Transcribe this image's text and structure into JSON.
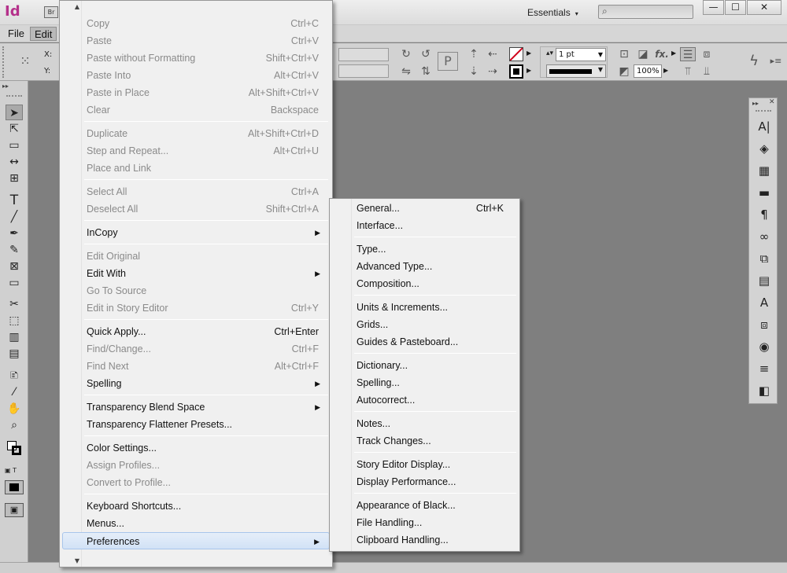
{
  "app": {
    "logo": "Id",
    "bridge": "Br",
    "workspace": "Essentials",
    "workspace_arrow": "▾"
  },
  "window_controls": {
    "minimize": "—",
    "maximize": "☐",
    "close": "✕"
  },
  "menubar": {
    "file": "File",
    "edit": "Edit"
  },
  "control_panel": {
    "x_label": "X:",
    "y_label": "Y:",
    "stroke_weight": "1 pt",
    "zoom_percent": "100%",
    "fx_label": "fx."
  },
  "edit_menu": {
    "items": [
      {
        "label": "Copy",
        "shortcut": "Ctrl+C",
        "enabled": false
      },
      {
        "label": "Paste",
        "shortcut": "Ctrl+V",
        "enabled": false
      },
      {
        "label": "Paste without Formatting",
        "shortcut": "Shift+Ctrl+V",
        "enabled": false
      },
      {
        "label": "Paste Into",
        "shortcut": "Alt+Ctrl+V",
        "enabled": false
      },
      {
        "label": "Paste in Place",
        "shortcut": "Alt+Shift+Ctrl+V",
        "enabled": false
      },
      {
        "label": "Clear",
        "shortcut": "Backspace",
        "enabled": false
      },
      {
        "label": "Duplicate",
        "shortcut": "Alt+Shift+Ctrl+D",
        "enabled": false
      },
      {
        "label": "Step and Repeat...",
        "shortcut": "Alt+Ctrl+U",
        "enabled": false
      },
      {
        "label": "Place and Link",
        "shortcut": "",
        "enabled": false
      },
      {
        "label": "Select All",
        "shortcut": "Ctrl+A",
        "enabled": false
      },
      {
        "label": "Deselect All",
        "shortcut": "Shift+Ctrl+A",
        "enabled": false
      },
      {
        "label": "InCopy",
        "shortcut": "",
        "enabled": true,
        "submenu": true
      },
      {
        "label": "Edit Original",
        "shortcut": "",
        "enabled": false
      },
      {
        "label": "Edit With",
        "shortcut": "",
        "enabled": true,
        "submenu": true
      },
      {
        "label": "Go To Source",
        "shortcut": "",
        "enabled": false
      },
      {
        "label": "Edit in Story Editor",
        "shortcut": "Ctrl+Y",
        "enabled": false
      },
      {
        "label": "Quick Apply...",
        "shortcut": "Ctrl+Enter",
        "enabled": true
      },
      {
        "label": "Find/Change...",
        "shortcut": "Ctrl+F",
        "enabled": false
      },
      {
        "label": "Find Next",
        "shortcut": "Alt+Ctrl+F",
        "enabled": false
      },
      {
        "label": "Spelling",
        "shortcut": "",
        "enabled": true,
        "submenu": true
      },
      {
        "label": "Transparency Blend Space",
        "shortcut": "",
        "enabled": true,
        "submenu": true
      },
      {
        "label": "Transparency Flattener Presets...",
        "shortcut": "",
        "enabled": true
      },
      {
        "label": "Color Settings...",
        "shortcut": "",
        "enabled": true
      },
      {
        "label": "Assign Profiles...",
        "shortcut": "",
        "enabled": false
      },
      {
        "label": "Convert to Profile...",
        "shortcut": "",
        "enabled": false
      },
      {
        "label": "Keyboard Shortcuts...",
        "shortcut": "",
        "enabled": true
      },
      {
        "label": "Menus...",
        "shortcut": "",
        "enabled": true
      },
      {
        "label": "Preferences",
        "shortcut": "",
        "enabled": true,
        "submenu": true,
        "highlighted": true
      }
    ],
    "submenu_arrow": "▶",
    "scroll_up": "▲",
    "scroll_down": "▼"
  },
  "preferences_menu": {
    "items": [
      {
        "label": "General...",
        "shortcut": "Ctrl+K"
      },
      {
        "label": "Interface...",
        "shortcut": ""
      },
      {
        "label": "Type...",
        "shortcut": ""
      },
      {
        "label": "Advanced Type...",
        "shortcut": ""
      },
      {
        "label": "Composition...",
        "shortcut": ""
      },
      {
        "label": "Units & Increments...",
        "shortcut": ""
      },
      {
        "label": "Grids...",
        "shortcut": ""
      },
      {
        "label": "Guides & Pasteboard...",
        "shortcut": ""
      },
      {
        "label": "Dictionary...",
        "shortcut": ""
      },
      {
        "label": "Spelling...",
        "shortcut": ""
      },
      {
        "label": "Autocorrect...",
        "shortcut": ""
      },
      {
        "label": "Notes...",
        "shortcut": ""
      },
      {
        "label": "Track Changes...",
        "shortcut": ""
      },
      {
        "label": "Story Editor Display...",
        "shortcut": ""
      },
      {
        "label": "Display Performance...",
        "shortcut": ""
      },
      {
        "label": "Appearance of Black...",
        "shortcut": ""
      },
      {
        "label": "File Handling...",
        "shortcut": ""
      },
      {
        "label": "Clipboard Handling...",
        "shortcut": ""
      }
    ]
  },
  "icons": {
    "tools": [
      "selection-icon",
      "direct-selection-icon",
      "page-tool-icon",
      "gap-tool-icon",
      "content-collector-icon",
      "type-tool-icon",
      "line-tool-icon",
      "pen-tool-icon",
      "pencil-tool-icon",
      "rectangle-frame-icon",
      "rectangle-tool-icon",
      "scissors-icon",
      "free-transform-icon",
      "gradient-swatch-icon",
      "gradient-feather-icon",
      "note-tool-icon",
      "eyedropper-icon",
      "hand-tool-icon",
      "zoom-tool-icon"
    ],
    "dock": [
      "character-styles-icon",
      "layers-icon",
      "swatches-icon",
      "gradient-icon",
      "paragraph-icon",
      "links-icon",
      "pages-icon",
      "text-wrap-icon",
      "character-icon",
      "effects-icon",
      "color-icon",
      "stroke-icon",
      "pathfinder-icon"
    ]
  }
}
